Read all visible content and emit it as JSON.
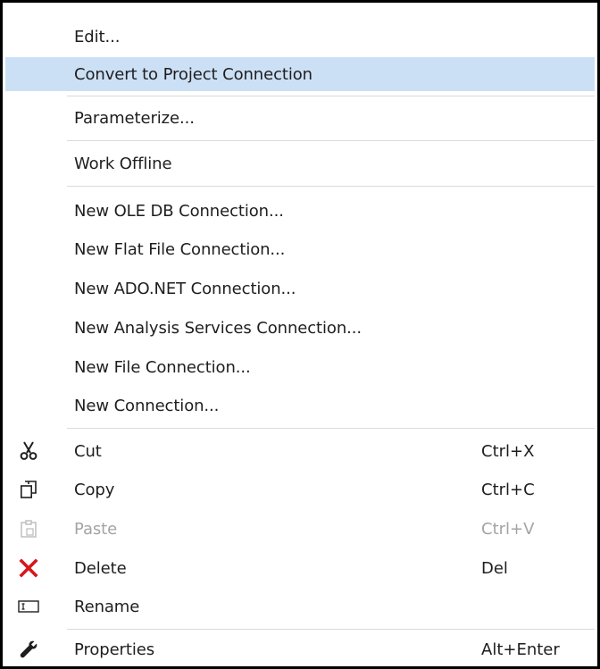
{
  "menu": {
    "items": [
      {
        "label": "Edit..."
      },
      {
        "label": "Convert to Project Connection"
      },
      {
        "label": "Parameterize..."
      },
      {
        "label": "Work Offline"
      },
      {
        "label": "New OLE DB Connection..."
      },
      {
        "label": "New Flat File Connection..."
      },
      {
        "label": "New ADO.NET Connection..."
      },
      {
        "label": "New Analysis Services Connection..."
      },
      {
        "label": "New File Connection..."
      },
      {
        "label": "New Connection..."
      },
      {
        "label": "Cut",
        "shortcut": "Ctrl+X",
        "icon": "scissors-icon"
      },
      {
        "label": "Copy",
        "shortcut": "Ctrl+C",
        "icon": "copy-icon"
      },
      {
        "label": "Paste",
        "shortcut": "Ctrl+V",
        "icon": "paste-icon",
        "disabled": true
      },
      {
        "label": "Delete",
        "shortcut": "Del",
        "icon": "delete-x-icon"
      },
      {
        "label": "Rename",
        "icon": "rename-icon"
      },
      {
        "label": "Properties",
        "shortcut": "Alt+Enter",
        "icon": "wrench-icon"
      }
    ],
    "highlighted_item": "Convert to Project Connection",
    "colors": {
      "highlight": "#cce0f5",
      "text": "#1e1e1e",
      "disabled_text": "#a2a4a5",
      "delete_icon": "#d4181b",
      "separator": "#dadada"
    }
  }
}
